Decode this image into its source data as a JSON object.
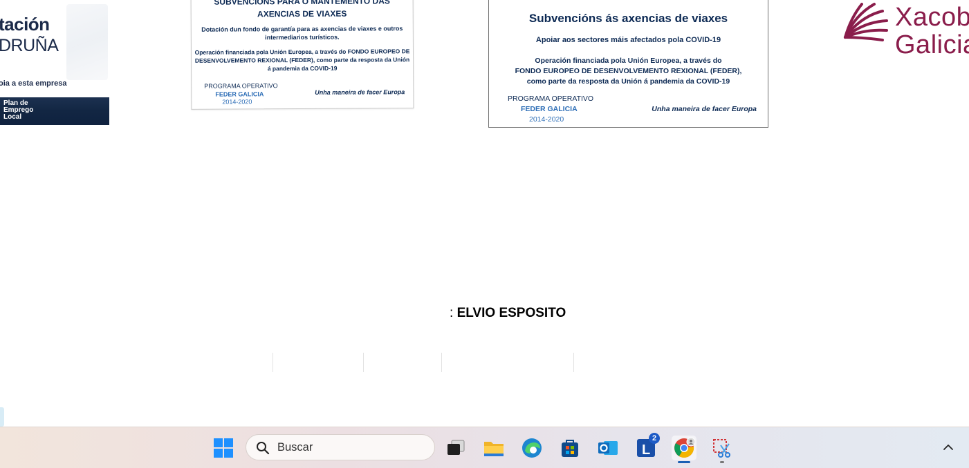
{
  "diputacion_logo": {
    "line1": "tación",
    "line2": "DRUÑA",
    "tagline": "oia a esta empresa",
    "band_lines": [
      "Plan de",
      "Emprego",
      "Local"
    ]
  },
  "feder_small": {
    "title_line1": "SUBVENCIÓNS PARA O MANTEMENTO DAS",
    "title_line2": "AXENCIAS DE VIAXES",
    "para1": "Dotación dun fondo de garantía para as axencias de viaxes e outros intermediarios turísticos.",
    "para2": "Operación financiada pola Unión Europea, a través do FONDO EUROPEO DE DESENVOLVEMENTO REXIONAL (FEDER), como parte da resposta da Unión á pandemia da COVID-19",
    "programa": "PROGRAMA OPERATIVO",
    "feder": "FEDER GALICIA",
    "years": "2014-2020",
    "motto": "Unha maneira de facer Europa"
  },
  "feder_large": {
    "title": "Subvencións ás axencias de viaxes",
    "subtitle": "Apoiar aos sectores máis afectados pola COVID-19",
    "para_line1": "Operación financiada pola Unión Europea, a través do",
    "para_line2": "FONDO EUROPEO DE DESENVOLVEMENTO REXIONAL (FEDER),",
    "para_line3": "como parte da resposta da Unión á pandemia da COVID-19",
    "programa": "PROGRAMA OPERATIVO",
    "feder": "FEDER GALICIA",
    "years": "2014-2020",
    "motto": "Unha maneira de facer Europa"
  },
  "xacobeo_logo": {
    "word1": "Xacob",
    "word2": "Galicia"
  },
  "author": {
    "prefix": ": ",
    "name": "ELVIO ESPOSITO"
  },
  "taskbar": {
    "search_placeholder": "Buscar",
    "icons": [
      "windows-start-icon",
      "task-view-icon",
      "file-explorer-icon",
      "edge-icon",
      "microsoft-store-icon",
      "outlook-icon",
      "l-app-icon",
      "chrome-icon",
      "snipping-tool-icon"
    ],
    "l_app_badge": "2",
    "colors": {
      "windows_blue": "#1e90ff",
      "outlook_blue": "#0f6cbd",
      "xacobeo_magenta": "#8a1d4b"
    }
  }
}
